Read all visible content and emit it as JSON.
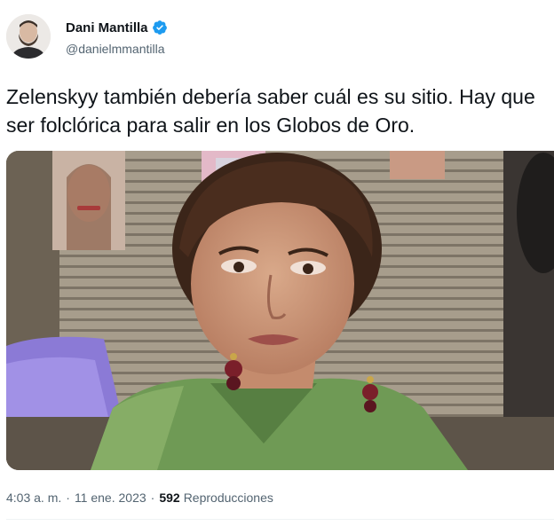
{
  "author": {
    "display_name": "Dani Mantilla",
    "handle": "@danielmmantilla",
    "verified": true,
    "verified_color": "#1d9bf0"
  },
  "tweet": {
    "text": "Zelenskyy también debería saber cuál es su sitio. Hay que ser folclórica para salir en los Globos de Oro."
  },
  "meta": {
    "time": "4:03 a. m.",
    "separator": "·",
    "date": "11 ene. 2023",
    "views_count": "592",
    "views_label": "Reproducciones"
  }
}
